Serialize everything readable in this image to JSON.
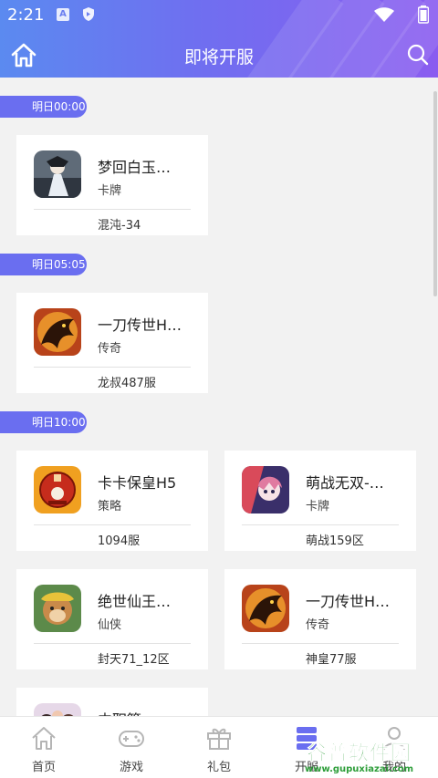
{
  "status_bar": {
    "time": "2:21",
    "a_badge": "A"
  },
  "header": {
    "title": "即将开服"
  },
  "sections": [
    {
      "time": "明日00:00",
      "games": [
        {
          "name": "梦回白玉…",
          "tag": "卡牌",
          "server": "混沌-34",
          "icon": "fantasy-game-icon"
        }
      ]
    },
    {
      "time": "明日05:05",
      "games": [
        {
          "name": "一刀传世H…",
          "tag": "传奇",
          "server": "龙叔487服",
          "icon": "dragon-game-icon"
        }
      ]
    },
    {
      "time": "明日10:00",
      "games": [
        {
          "name": "卡卡保皇H5",
          "tag": "策略",
          "server": "1094服",
          "icon": "emblem-game-icon"
        },
        {
          "name": "萌战无双-…",
          "tag": "卡牌",
          "server": "萌战159区",
          "icon": "anime-game-icon"
        },
        {
          "name": "绝世仙王…",
          "tag": "仙侠",
          "server": "封天71_12区",
          "icon": "monkey-king-game-icon"
        },
        {
          "name": "一刀传世H…",
          "tag": "传奇",
          "server": "神皇77服",
          "icon": "dragon-game-icon"
        },
        {
          "name": "中职篮:…",
          "tag": "",
          "server": "",
          "icon": "basketball-game-icon"
        }
      ]
    }
  ],
  "tabs": [
    {
      "label": "首页",
      "icon": "home-icon"
    },
    {
      "label": "游戏",
      "icon": "gamepad-icon"
    },
    {
      "label": "礼包",
      "icon": "gift-icon"
    },
    {
      "label": "开服",
      "icon": "server-icon"
    },
    {
      "label": "我的",
      "icon": "user-icon"
    }
  ],
  "watermark": {
    "logo": "谷普软件园",
    "url": "www.gupuxiazai.com"
  },
  "colors": {
    "header_start": "#5b8af0",
    "header_end": "#8a5cf0",
    "pill": "#6a6ef0",
    "watermark": "#2e9e3a"
  }
}
